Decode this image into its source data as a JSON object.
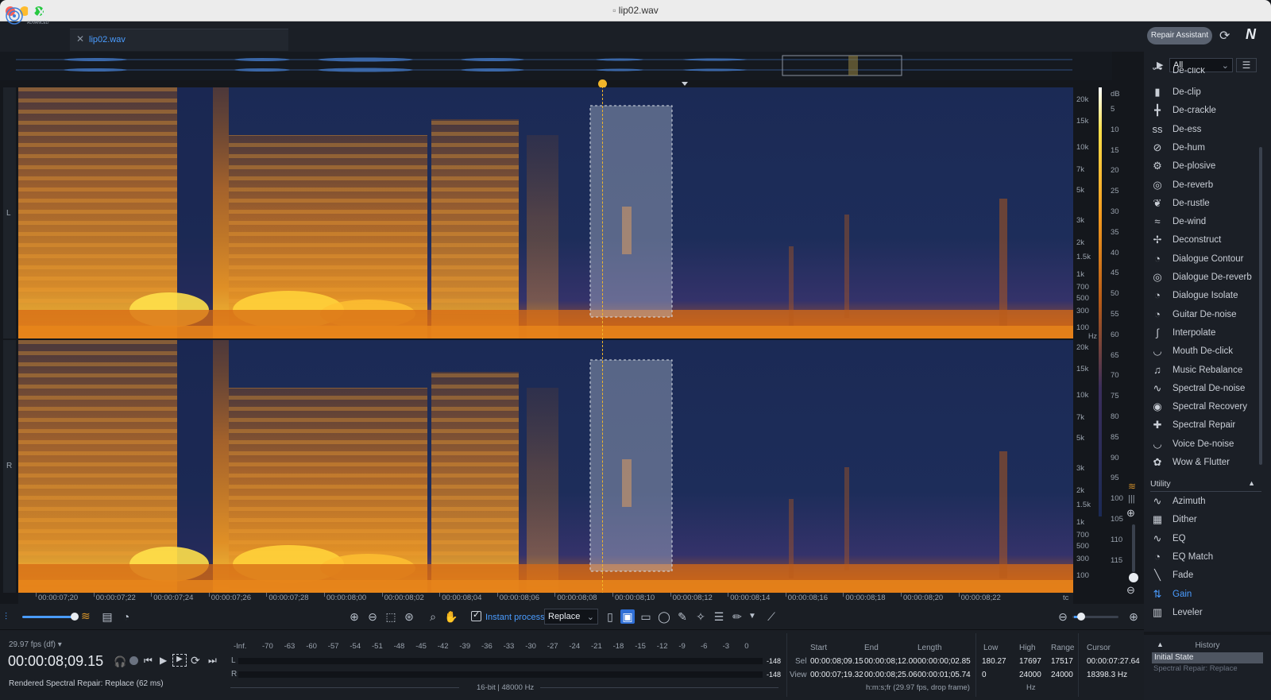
{
  "window": {
    "title": "lip02.wav"
  },
  "header": {
    "logo_main": "RX",
    "logo_sub": "ADVANCED",
    "tab_name": "lip02.wav",
    "repair_assistant": "Repair Assistant",
    "logo_ni": "N"
  },
  "channels": {
    "left": "L",
    "right": "R"
  },
  "freq_ticks": [
    "20k",
    "15k",
    "10k",
    "7k",
    "5k",
    "3k",
    "2k",
    "1.5k",
    "1k",
    "700",
    "500",
    "300",
    "100"
  ],
  "freq_unit": "Hz",
  "db_unit": "dB",
  "db_ticks": [
    "5",
    "10",
    "15",
    "20",
    "25",
    "30",
    "35",
    "40",
    "45",
    "50",
    "55",
    "60",
    "65",
    "70",
    "75",
    "80",
    "85",
    "90",
    "95",
    "100",
    "105",
    "110",
    "115"
  ],
  "time_ticks": [
    "00:00:07;20",
    "00:00:07;22",
    "00:00:07;24",
    "00:00:07;26",
    "00:00:07;28",
    "00:00:08;00",
    "00:00:08;02",
    "00:00:08;04",
    "00:00:08;06",
    "00:00:08;08",
    "00:00:08;10",
    "00:00:08;12",
    "00:00:08;14",
    "00:00:08;16",
    "00:00:08;18",
    "00:00:08;20",
    "00:00:08;22"
  ],
  "time_unit": "tc",
  "toolbar": {
    "instant_process": "Instant process",
    "mode": "Replace"
  },
  "transport": {
    "fps": "29.97 fps (df)",
    "timecode": "00:00:08;09.15",
    "status": "Rendered Spectral Repair: Replace (62 ms)"
  },
  "meter": {
    "scale": [
      "-Inf.",
      "-70",
      "-63",
      "-60",
      "-57",
      "-54",
      "-51",
      "-48",
      "-45",
      "-42",
      "-39",
      "-36",
      "-33",
      "-30",
      "-27",
      "-24",
      "-21",
      "-18",
      "-15",
      "-12",
      "-9",
      "-6",
      "-3",
      "0"
    ],
    "l_label": "L",
    "r_label": "R",
    "l_peak": "-148",
    "r_peak": "-148",
    "format": "16-bit | 48000 Hz"
  },
  "selection": {
    "headers": [
      "Start",
      "End",
      "Length"
    ],
    "sel_label": "Sel",
    "view_label": "View",
    "sel": [
      "00:00:08;09.15",
      "00:00:08;12.00",
      "00:00:00;02.85"
    ],
    "view": [
      "00:00:07;19.32",
      "00:00:08;25.06",
      "00:00:01;05.74"
    ],
    "format": "h:m:s;fr (29.97 fps, drop frame)"
  },
  "freqinfo": {
    "headers": [
      "Low",
      "High",
      "Range"
    ],
    "sel": [
      "180.27",
      "17697",
      "17517"
    ],
    "view": [
      "0",
      "24000",
      "24000"
    ],
    "unit": "Hz"
  },
  "cursor": {
    "header": "Cursor",
    "time": "00:00:07:27.64",
    "freq": "18398.3 Hz"
  },
  "modules": {
    "filter": "All",
    "items": [
      "De-click",
      "De-clip",
      "De-crackle",
      "De-ess",
      "De-hum",
      "De-plosive",
      "De-reverb",
      "De-rustle",
      "De-wind",
      "Deconstruct",
      "Dialogue Contour",
      "Dialogue De-reverb",
      "Dialogue Isolate",
      "Guitar De-noise",
      "Interpolate",
      "Mouth De-click",
      "Music Rebalance",
      "Spectral De-noise",
      "Spectral Recovery",
      "Spectral Repair",
      "Voice De-noise",
      "Wow & Flutter"
    ],
    "utility_label": "Utility",
    "utility": [
      "Azimuth",
      "Dither",
      "EQ",
      "EQ Match",
      "Fade",
      "Gain",
      "Leveler"
    ]
  },
  "history": {
    "title": "History",
    "items": [
      "Initial State",
      "Spectral Repair: Replace"
    ]
  },
  "colors": {
    "accent": "#4a9cff",
    "cursor": "#f1b52a",
    "bg": "#14171c"
  }
}
